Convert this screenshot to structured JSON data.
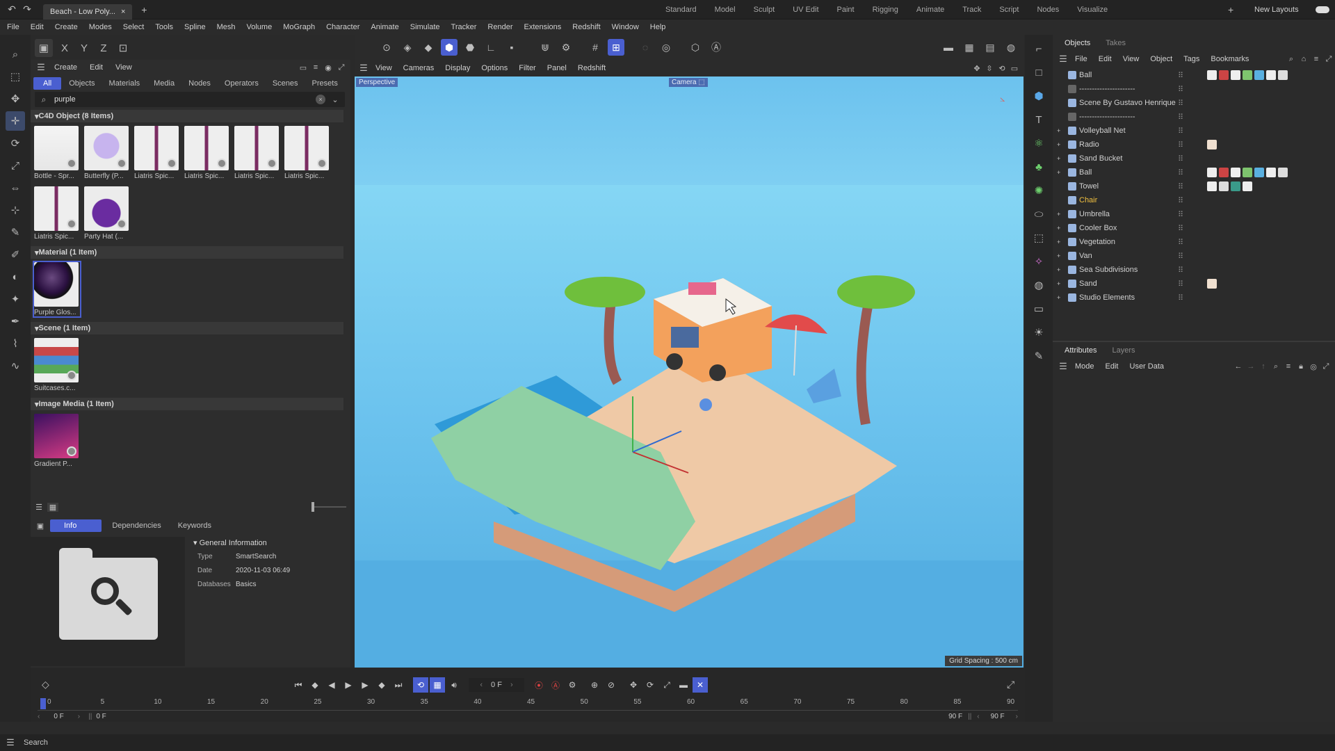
{
  "window": {
    "tab_title": "Beach - Low Poly...",
    "tab_close": "×",
    "tab_add": "+",
    "layouts": [
      "Standard",
      "Model",
      "Sculpt",
      "UV Edit",
      "Paint",
      "Rigging",
      "Animate",
      "Track",
      "Script",
      "Nodes",
      "Visualize"
    ],
    "layout_add": "+",
    "new_layouts": "New Layouts"
  },
  "menu": [
    "File",
    "Edit",
    "Create",
    "Modes",
    "Select",
    "Tools",
    "Spline",
    "Mesh",
    "Volume",
    "MoGraph",
    "Character",
    "Animate",
    "Simulate",
    "Tracker",
    "Render",
    "Extensions",
    "Redshift",
    "Window",
    "Help"
  ],
  "asset_browser": {
    "menu": [
      "Create",
      "Edit",
      "View"
    ],
    "filters": [
      "All",
      "Objects",
      "Materials",
      "Media",
      "Nodes",
      "Operators",
      "Scenes",
      "Presets"
    ],
    "search_value": "purple",
    "sections": [
      {
        "title": "C4D Object (8 Items)",
        "items": [
          "Bottle - Spr...",
          "Butterfly (P...",
          "Liatris Spic...",
          "Liatris Spic...",
          "Liatris Spic...",
          "Liatris Spic...",
          "Liatris Spic...",
          "Party Hat (..."
        ]
      },
      {
        "title": "Material (1 Item)",
        "items": [
          "Purple Glos..."
        ]
      },
      {
        "title": "Scene (1 Item)",
        "items": [
          "Suitcases.c..."
        ]
      },
      {
        "title": "Image Media (1 Item)",
        "items": [
          "Gradient P..."
        ]
      }
    ]
  },
  "info_panel": {
    "tabs": [
      "Info",
      "Dependencies",
      "Keywords"
    ],
    "group_title": "General Information",
    "fields": [
      {
        "label": "Type",
        "value": "SmartSearch"
      },
      {
        "label": "Date",
        "value": "2020-11-03 06:49"
      },
      {
        "label": "Databases",
        "value": "Basics"
      }
    ]
  },
  "viewport": {
    "menu": [
      "View",
      "Cameras",
      "Display",
      "Options",
      "Filter",
      "Panel",
      "Redshift"
    ],
    "view_name": "Perspective",
    "camera_label": "Camera",
    "grid_spacing": "Grid Spacing : 500 cm"
  },
  "objects_panel": {
    "tabs": [
      "Objects",
      "Takes"
    ],
    "menu": [
      "File",
      "Edit",
      "View",
      "Object",
      "Tags",
      "Bookmarks"
    ],
    "items": [
      "Ball",
      "----------------------",
      "Scene By Gustavo Henrique",
      "----------------------",
      "Volleyball Net",
      "Radio",
      "Sand Bucket",
      "Ball",
      "Towel",
      "Chair",
      "Umbrella",
      "Cooler Box",
      "Vegetation",
      "Van",
      "Sea Subdivisions",
      "Sand",
      "Studio Elements"
    ]
  },
  "attributes_panel": {
    "tabs": [
      "Attributes",
      "Layers"
    ],
    "menu": [
      "Mode",
      "Edit",
      "User Data"
    ]
  },
  "timeline": {
    "current_frame": "0 F",
    "ticks": [
      "0",
      "5",
      "10",
      "15",
      "20",
      "25",
      "30",
      "35",
      "40",
      "45",
      "50",
      "55",
      "60",
      "65",
      "70",
      "75",
      "80",
      "85",
      "90"
    ],
    "start_frame": "0 F",
    "range_start": "0 F",
    "range_end": "90 F",
    "end_frame": "90 F"
  },
  "status": {
    "search_label": "Search"
  },
  "colors": {
    "accent": "#4a5fd0",
    "sky": "#6fc4ee",
    "viewport_floor": "#54aee2"
  }
}
